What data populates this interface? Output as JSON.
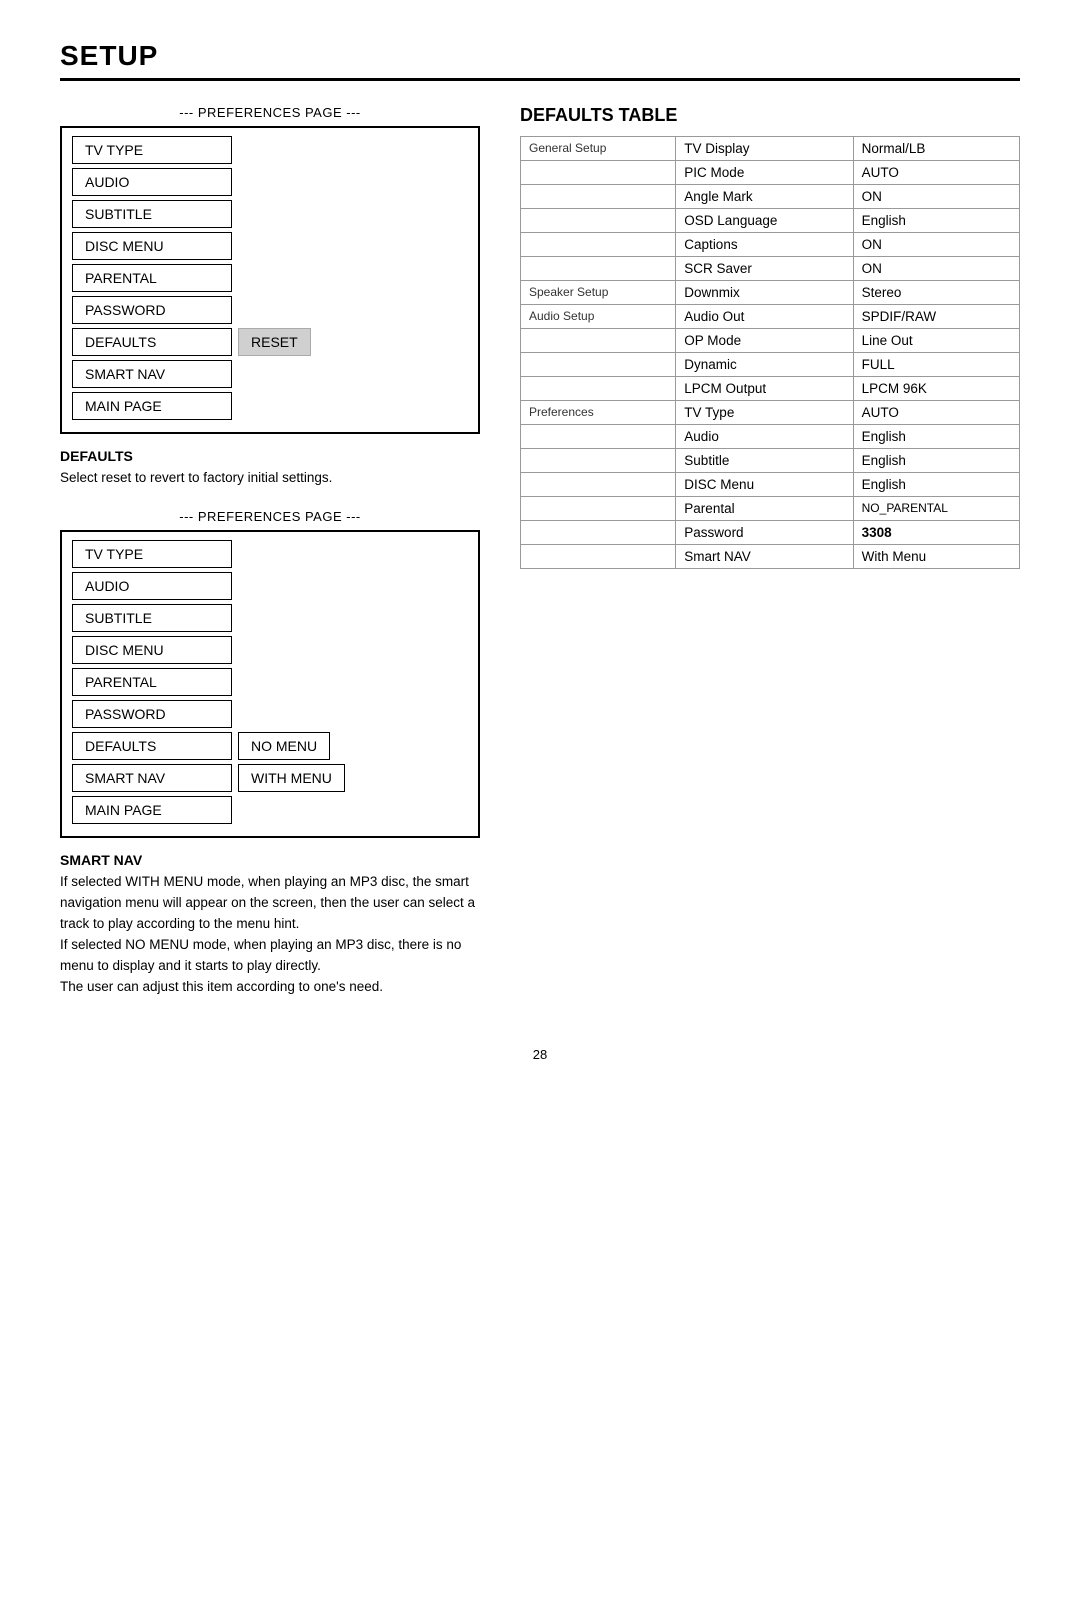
{
  "page": {
    "title": "SETUP",
    "page_number": "28"
  },
  "left": {
    "section1": {
      "header": "--- PREFERENCES PAGE ---",
      "menu_items": [
        {
          "label": "TV TYPE",
          "extra": null
        },
        {
          "label": "AUDIO",
          "extra": null
        },
        {
          "label": "SUBTITLE",
          "extra": null
        },
        {
          "label": "DISC MENU",
          "extra": null
        },
        {
          "label": "PARENTAL",
          "extra": null
        },
        {
          "label": "PASSWORD",
          "extra": null
        },
        {
          "label": "DEFAULTS",
          "extra": "RESET",
          "extra_style": "gray"
        },
        {
          "label": "SMART NAV",
          "extra": null
        },
        {
          "label": "MAIN PAGE",
          "extra": null
        }
      ]
    },
    "defaults_desc": {
      "title": "DEFAULTS",
      "text": "Select reset to revert to factory initial settings."
    },
    "section2": {
      "header": "--- PREFERENCES PAGE ---",
      "menu_items": [
        {
          "label": "TV TYPE",
          "extra": null
        },
        {
          "label": "AUDIO",
          "extra": null
        },
        {
          "label": "SUBTITLE",
          "extra": null
        },
        {
          "label": "DISC MENU",
          "extra": null
        },
        {
          "label": "PARENTAL",
          "extra": null
        },
        {
          "label": "PASSWORD",
          "extra": null
        },
        {
          "label": "DEFAULTS",
          "extra": "NO MENU",
          "extra_style": "white"
        },
        {
          "label": "SMART NAV",
          "extra": "WITH MENU",
          "extra_style": "white"
        },
        {
          "label": "MAIN PAGE",
          "extra": null
        }
      ]
    },
    "smartnav_desc": {
      "title": "SMART NAV",
      "text": "If selected WITH MENU mode, when playing an MP3 disc, the smart navigation menu will appear on the screen, then the user can select a track to play according to the menu hint.\nIf selected NO MENU mode, when playing an MP3 disc, there is no menu to display and it starts to play directly.\nThe user can adjust this item according to one’s need."
    }
  },
  "right": {
    "defaults_table": {
      "title": "DEFAULTS TABLE",
      "rows": [
        {
          "col1": "General Setup",
          "col2": "TV Display",
          "col3": "Normal/LB"
        },
        {
          "col1": "",
          "col2": "PIC Mode",
          "col3": "AUTO"
        },
        {
          "col1": "",
          "col2": "Angle Mark",
          "col3": "ON"
        },
        {
          "col1": "",
          "col2": "OSD Language",
          "col3": "English"
        },
        {
          "col1": "",
          "col2": "Captions",
          "col3": "ON"
        },
        {
          "col1": "",
          "col2": "SCR Saver",
          "col3": "ON"
        },
        {
          "col1": "Speaker Setup",
          "col2": "Downmix",
          "col3": "Stereo"
        },
        {
          "col1": "Audio Setup",
          "col2": "Audio Out",
          "col3": "SPDIF/RAW"
        },
        {
          "col1": "",
          "col2": "OP Mode",
          "col3": "Line Out"
        },
        {
          "col1": "",
          "col2": "Dynamic",
          "col3": "FULL"
        },
        {
          "col1": "",
          "col2": "LPCM Output",
          "col3": "LPCM 96K"
        },
        {
          "col1": "Preferences",
          "col2": "TV Type",
          "col3": "AUTO"
        },
        {
          "col1": "",
          "col2": "Audio",
          "col3": "English"
        },
        {
          "col1": "",
          "col2": "Subtitle",
          "col3": "English"
        },
        {
          "col1": "",
          "col2": "DISC Menu",
          "col3": "English"
        },
        {
          "col1": "",
          "col2": "Parental",
          "col3": "NO_PARENTAL"
        },
        {
          "col1": "",
          "col2": "Password",
          "col3": "3308",
          "col3_bold": true
        },
        {
          "col1": "",
          "col2": "Smart NAV",
          "col3": "With Menu"
        }
      ]
    }
  }
}
